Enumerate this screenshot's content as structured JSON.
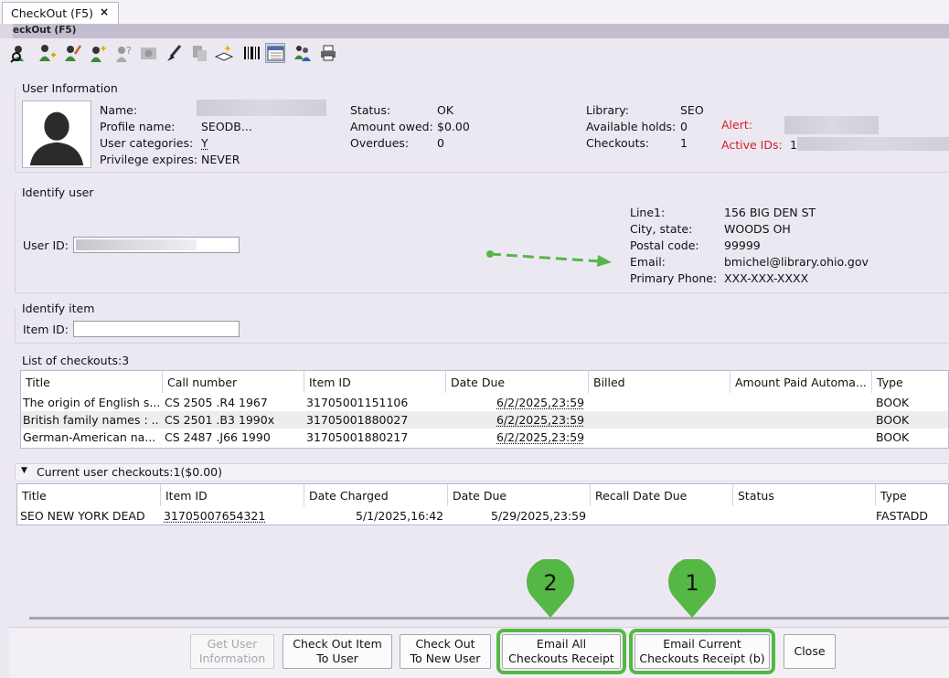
{
  "tab": {
    "title": "CheckOut (F5)",
    "close": "×"
  },
  "window": {
    "subtitle": "eckOut (F5)"
  },
  "toolbar": {
    "icons": [
      "user-search-icon",
      "user-add-icon",
      "user-edit-icon",
      "user-new-icon",
      "user-unknown-icon",
      "bill-icon",
      "brush-icon",
      "copy-icon",
      "book-add-icon",
      "barcode-icon",
      "calendar-icon",
      "users-group-icon",
      "printer-icon"
    ]
  },
  "user_info": {
    "section": "User Information",
    "name_label": "Name:",
    "profile_label": "Profile name:",
    "profile_value": "SEODB...",
    "categories_label": "User categories:",
    "categories_value": "Y",
    "privilege_label": "Privilege expires:",
    "privilege_value": "NEVER",
    "status_label": "Status:",
    "status_value": "OK",
    "owed_label": "Amount owed:",
    "owed_value": "$0.00",
    "overdues_label": "Overdues:",
    "overdues_value": "0",
    "library_label": "Library:",
    "library_value": "SEO",
    "holds_label": "Available holds:",
    "holds_value": "0",
    "checkouts_label": "Checkouts:",
    "checkouts_value": "1",
    "alert_label": "Alert:",
    "active_ids_label": "Active IDs:",
    "active_ids_value": "1",
    "alert_color": "#d22020"
  },
  "identify_user": {
    "section": "Identify user",
    "user_id_label": "User ID:",
    "line1_label": "Line1:",
    "line1_value": "156 BIG DEN ST",
    "city_label": "City, state:",
    "city_value": "WOODS OH",
    "postal_label": "Postal code:",
    "postal_value": "99999",
    "email_label": "Email:",
    "email_value": "bmichel@library.ohio.gov",
    "phone_label": "Primary Phone:",
    "phone_value": "XXX-XXX-XXXX",
    "arrow_color": "#55b845"
  },
  "identify_item": {
    "section": "Identify item",
    "item_id_label": "Item ID:"
  },
  "checkouts_list": {
    "title": "List of checkouts:3",
    "columns": [
      "Title",
      "Call number",
      "Item ID",
      "Date Due",
      "Billed",
      "Amount Paid Automa...",
      "Type"
    ],
    "rows": [
      [
        "The origin of English s...",
        "CS 2505 .R4 1967",
        "31705001151106",
        "6/2/2025,23:59",
        "",
        "",
        "BOOK"
      ],
      [
        "British family names : ...",
        "CS 2501 .B3 1990x",
        "31705001880027",
        "6/2/2025,23:59",
        "",
        "",
        "BOOK"
      ],
      [
        "German-American na...",
        "CS 2487 .J66 1990",
        "31705001880217",
        "6/2/2025,23:59",
        "",
        "",
        "BOOK"
      ]
    ]
  },
  "current_checkouts": {
    "title": "Current user checkouts:1($0.00)",
    "columns": [
      "Title",
      "Item ID",
      "Date Charged",
      "Date Due",
      "Recall Date Due",
      "Status",
      "Type"
    ],
    "rows": [
      [
        "SEO NEW YORK DEAD",
        "31705007654321",
        "5/1/2025,16:42",
        "5/29/2025,23:59",
        "",
        "",
        "FASTADD"
      ]
    ]
  },
  "buttons": {
    "get_user_1": "Get User",
    "get_user_2": "Information",
    "checkout_item_1": "Check Out Item",
    "checkout_item_2": "To User",
    "checkout_new_1": "Check Out",
    "checkout_new_2": "To New User",
    "email_all_1": "Email All",
    "email_all_2": "Checkouts Receipt",
    "email_current_1": "Email Current",
    "email_current_2": "Checkouts Receipt (b)",
    "close": "Close"
  },
  "markers": {
    "first": "1",
    "second": "2",
    "color": "#55b845"
  }
}
